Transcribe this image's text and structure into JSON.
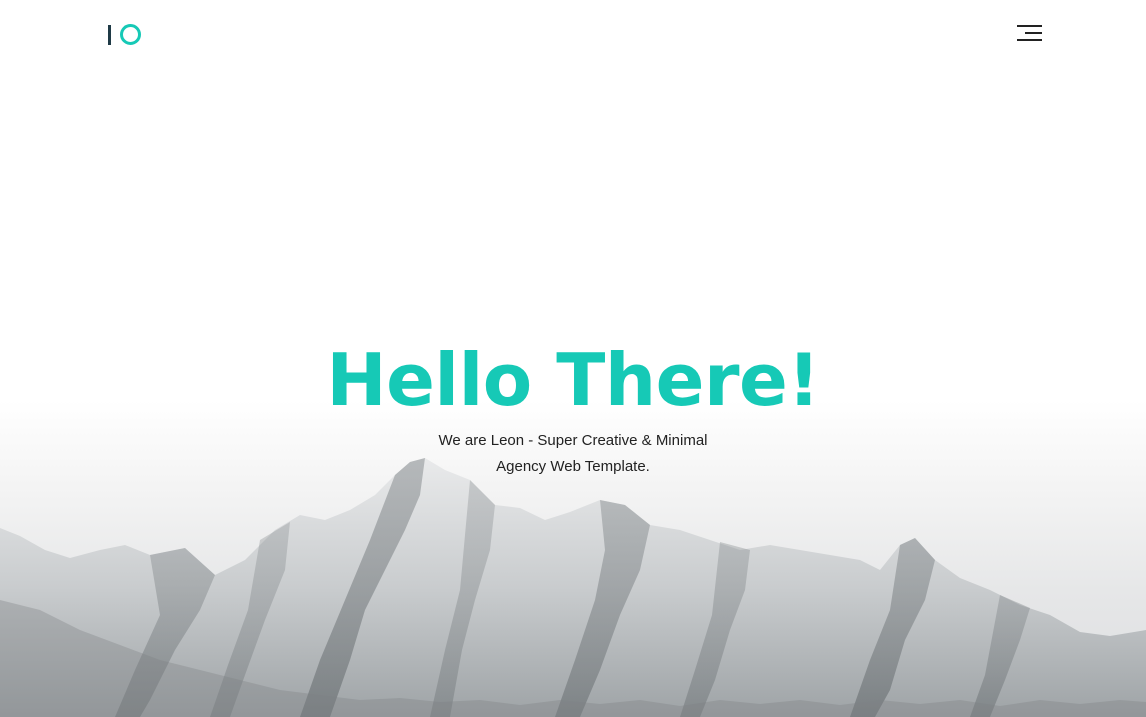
{
  "header": {
    "logo_icon": "io-logo-icon",
    "menu_icon": "hamburger-menu-icon"
  },
  "hero": {
    "title": "Hello There!",
    "subtitle_line1": "We are Leon - Super Creative & Minimal",
    "subtitle_line2": "Agency Web Template.",
    "background_image": "snowy-mountain-range"
  },
  "colors": {
    "accent": "#16c9b6",
    "logo_dark": "#1f3a46",
    "text": "#222222",
    "background": "#ffffff"
  }
}
